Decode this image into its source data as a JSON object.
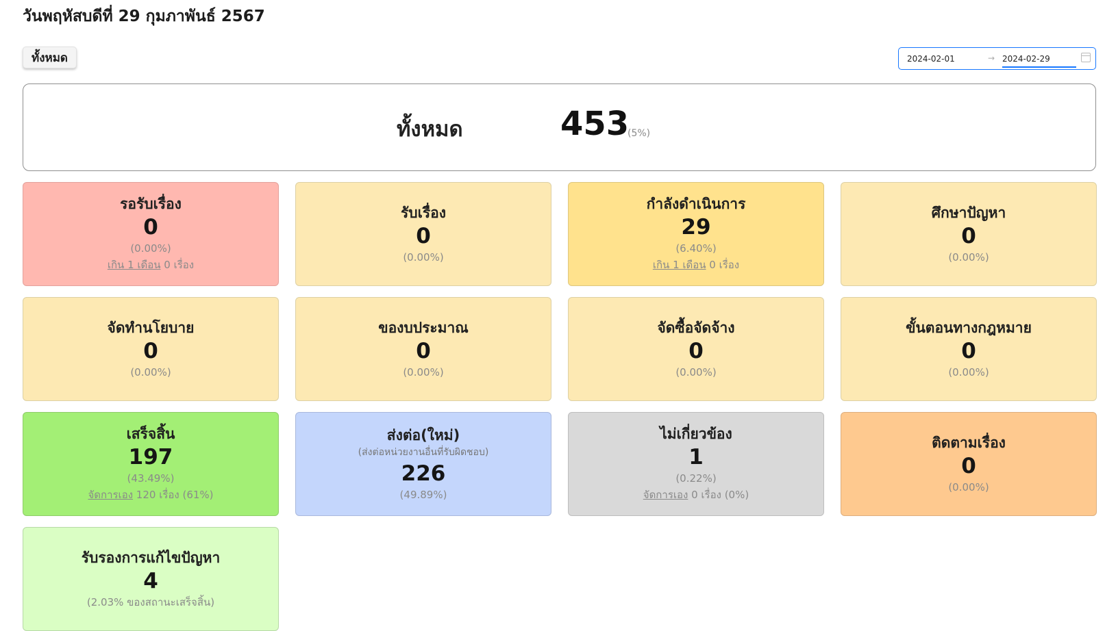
{
  "header": {
    "date_title": "วันพฤหัสบดีที่ 29 กุมภาพันธ์ 2567",
    "all_button": "ทั้งหมด"
  },
  "date_range": {
    "start": "2024-02-01",
    "end": "2024-02-29",
    "separator": "→"
  },
  "total": {
    "label": "ทั้งหมด",
    "value": "453",
    "percent": "(5%)"
  },
  "colors": {
    "pending": "#ffb8b0",
    "light_yellow": "#fde9b3",
    "yellow": "#ffe28d",
    "green": "#a3ef75",
    "blue": "#c4d6fc",
    "gray": "#d9d9d9",
    "orange": "#fec98f",
    "light_green": "#dafec4"
  },
  "cards": [
    {
      "title": "รอรับเรื่อง",
      "value": "0",
      "percent": "(0.00%)",
      "extra_link": "เกิน 1 เดือน",
      "extra_text": " 0 เรื่อง",
      "color": "#ffb8b0",
      "border": "#e3a19b"
    },
    {
      "title": "รับเรื่อง",
      "value": "0",
      "percent": "(0.00%)",
      "color": "#fde9b3",
      "border": "#ddd0a4"
    },
    {
      "title": "กำลังดำเนินการ",
      "value": "29",
      "percent": "(6.40%)",
      "extra_link": "เกิน 1 เดือน",
      "extra_text": " 0 เรื่อง",
      "color": "#ffe28d",
      "border": "#ddc67e"
    },
    {
      "title": "ศึกษาปัญหา",
      "value": "0",
      "percent": "(0.00%)",
      "color": "#fde9b3",
      "border": "#ddd0a4"
    },
    {
      "title": "จัดทำนโยบาย",
      "value": "0",
      "percent": "(0.00%)",
      "color": "#fde9b3",
      "border": "#ddd0a4"
    },
    {
      "title": "ของบประมาณ",
      "value": "0",
      "percent": "(0.00%)",
      "color": "#fde9b3",
      "border": "#ddd0a4"
    },
    {
      "title": "จัดซื้อจัดจ้าง",
      "value": "0",
      "percent": "(0.00%)",
      "color": "#fde9b3",
      "border": "#ddd0a4"
    },
    {
      "title": "ขั้นตอนทางกฎหมาย",
      "value": "0",
      "percent": "(0.00%)",
      "color": "#fde9b3",
      "border": "#ddd0a4"
    },
    {
      "title": "เสร็จสิ้น",
      "value": "197",
      "percent": "(43.49%)",
      "extra_link": "จัดการเอง",
      "extra_text": " 120 เรื่อง (61%)",
      "color": "#a3ef75",
      "border": "#8fcc6a"
    },
    {
      "title": "ส่งต่อ(ใหม่)",
      "subtitle": "(ส่งต่อหน่วยงานอื่นที่รับผิดชอบ)",
      "value": "226",
      "percent": "(49.89%)",
      "color": "#c4d6fc",
      "border": "#a9b8dc"
    },
    {
      "title": "ไม่เกี่ยวข้อง",
      "value": "1",
      "percent": "(0.22%)",
      "extra_link": "จัดการเอง",
      "extra_text": " 0 เรื่อง (0%)",
      "color": "#d9d9d9",
      "border": "#bdbdbd"
    },
    {
      "title": "ติดตามเรื่อง",
      "value": "0",
      "percent": "(0.00%)",
      "color": "#fec98f",
      "border": "#ddae7e"
    },
    {
      "title": "รับรองการแก้ไขปัญหา",
      "value": "4",
      "percent": "(2.03% ของสถานะเสร็จสิ้น)",
      "color": "#dafec4",
      "border": "#b7d9a6"
    }
  ]
}
